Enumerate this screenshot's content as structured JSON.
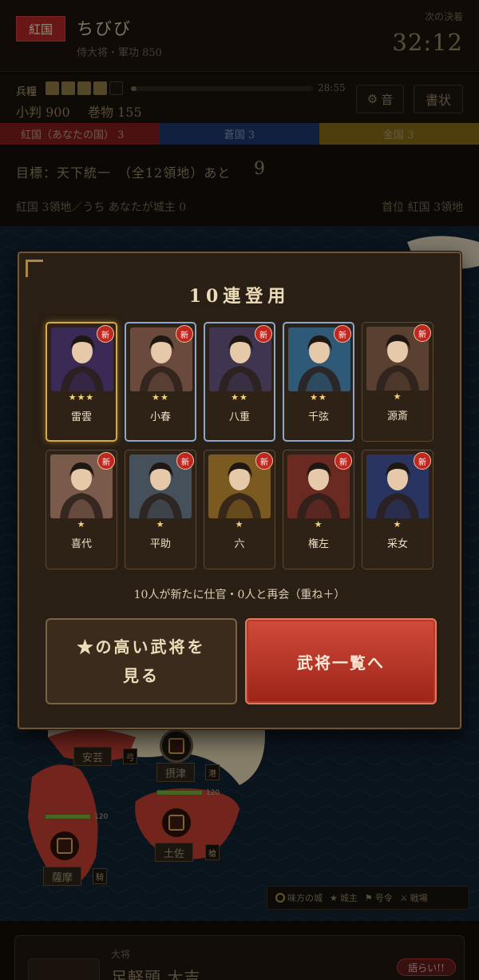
{
  "header": {
    "faction_badge": "紅国",
    "player_name": "ちびび",
    "player_rank": "侍大将・軍功 850",
    "timer_label": "次の決着",
    "timer_value": "32:12"
  },
  "resources": {
    "food_label": "兵糧",
    "food_level": 4,
    "food_max": 5,
    "progress_fraction": 0.03,
    "progress_time": "28:55",
    "coins": "小判 900",
    "scrolls": "巻物 155",
    "sound_icon": "gear-icon",
    "sound_label": "音",
    "letter_label": "書状"
  },
  "factions": {
    "red": "紅国（あなたの国） 3",
    "blue": "蒼国 3",
    "gold": "金国 3",
    "colors": {
      "red": "#7a1c1c",
      "blue": "#1c3565",
      "gold": "#7e6416"
    }
  },
  "objective": {
    "main": "目標：天下統一　（全12領地）あと",
    "remaining": "9",
    "status": "紅国 3領地／うち あなたが城主 0",
    "leader": "首位 紅国 3領地"
  },
  "map": {
    "provinces": [
      {
        "name": "安芸",
        "tag": "弓",
        "hp": ""
      },
      {
        "name": "摂津",
        "tag": "港",
        "hp": ""
      },
      {
        "name": "土佐",
        "tag": "槍",
        "hp": "120"
      },
      {
        "name": "薩摩",
        "tag": "騎",
        "hp": "120"
      }
    ],
    "legend": {
      "ally": "味方の城",
      "lord": "城主",
      "command": "号令",
      "battle": "戦場"
    }
  },
  "bottom": {
    "rank": "大将",
    "name": "足軽頭 大吉",
    "chat": "語らい!!"
  },
  "modal": {
    "title": "10連登用",
    "new_badge": "新",
    "cards": [
      {
        "name": "雷雲",
        "stars": "★★★",
        "rarity": "gold",
        "icon": "samurai-portrait"
      },
      {
        "name": "小春",
        "stars": "★★",
        "rarity": "blue",
        "icon": "maiden-portrait"
      },
      {
        "name": "八重",
        "stars": "★★",
        "rarity": "blue",
        "icon": "biwa-player-portrait"
      },
      {
        "name": "千弦",
        "stars": "★★",
        "rarity": "blue",
        "icon": "archer-portrait"
      },
      {
        "name": "源斎",
        "stars": "★",
        "rarity": "normal",
        "icon": "elder-portrait"
      },
      {
        "name": "喜代",
        "stars": "★",
        "rarity": "normal",
        "icon": "shamisen-portrait"
      },
      {
        "name": "平助",
        "stars": "★",
        "rarity": "normal",
        "icon": "soldier-portrait"
      },
      {
        "name": "六",
        "stars": "★",
        "rarity": "normal",
        "icon": "miner-portrait"
      },
      {
        "name": "権左",
        "stars": "★",
        "rarity": "normal",
        "icon": "ronin-portrait"
      },
      {
        "name": "采女",
        "stars": "★",
        "rarity": "normal",
        "icon": "scholar-portrait"
      }
    ],
    "summary": "10人が新たに仕官・0人と再会（重ね＋）",
    "btn_high_line1": "★の高い武将を",
    "btn_high_line2": "見る",
    "btn_list": "武将一覧へ",
    "palette": [
      "#3b2a55",
      "#6a4a3c",
      "#3f3550",
      "#2e5a78",
      "#5a4030",
      "#7a5a4a",
      "#45505a",
      "#7a5a20",
      "#6a2a22",
      "#2a3460"
    ]
  }
}
